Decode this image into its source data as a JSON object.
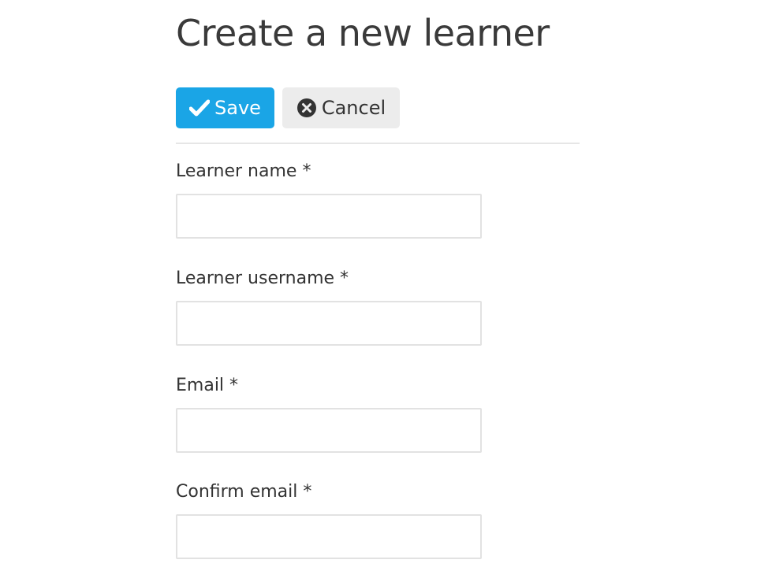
{
  "page": {
    "title": "Create a new learner"
  },
  "toolbar": {
    "save_label": "Save",
    "cancel_label": "Cancel",
    "save_icon": "check-icon",
    "cancel_icon": "close-circle-icon"
  },
  "form": {
    "fields": [
      {
        "label": "Learner name *",
        "value": "",
        "placeholder": ""
      },
      {
        "label": "Learner username *",
        "value": "",
        "placeholder": ""
      },
      {
        "label": "Email *",
        "value": "",
        "placeholder": ""
      },
      {
        "label": "Confirm email *",
        "value": "",
        "placeholder": ""
      }
    ]
  },
  "colors": {
    "accent": "#1aa5e6",
    "secondary_button": "#ececec",
    "border": "#e2e2e2",
    "text": "#333333"
  }
}
